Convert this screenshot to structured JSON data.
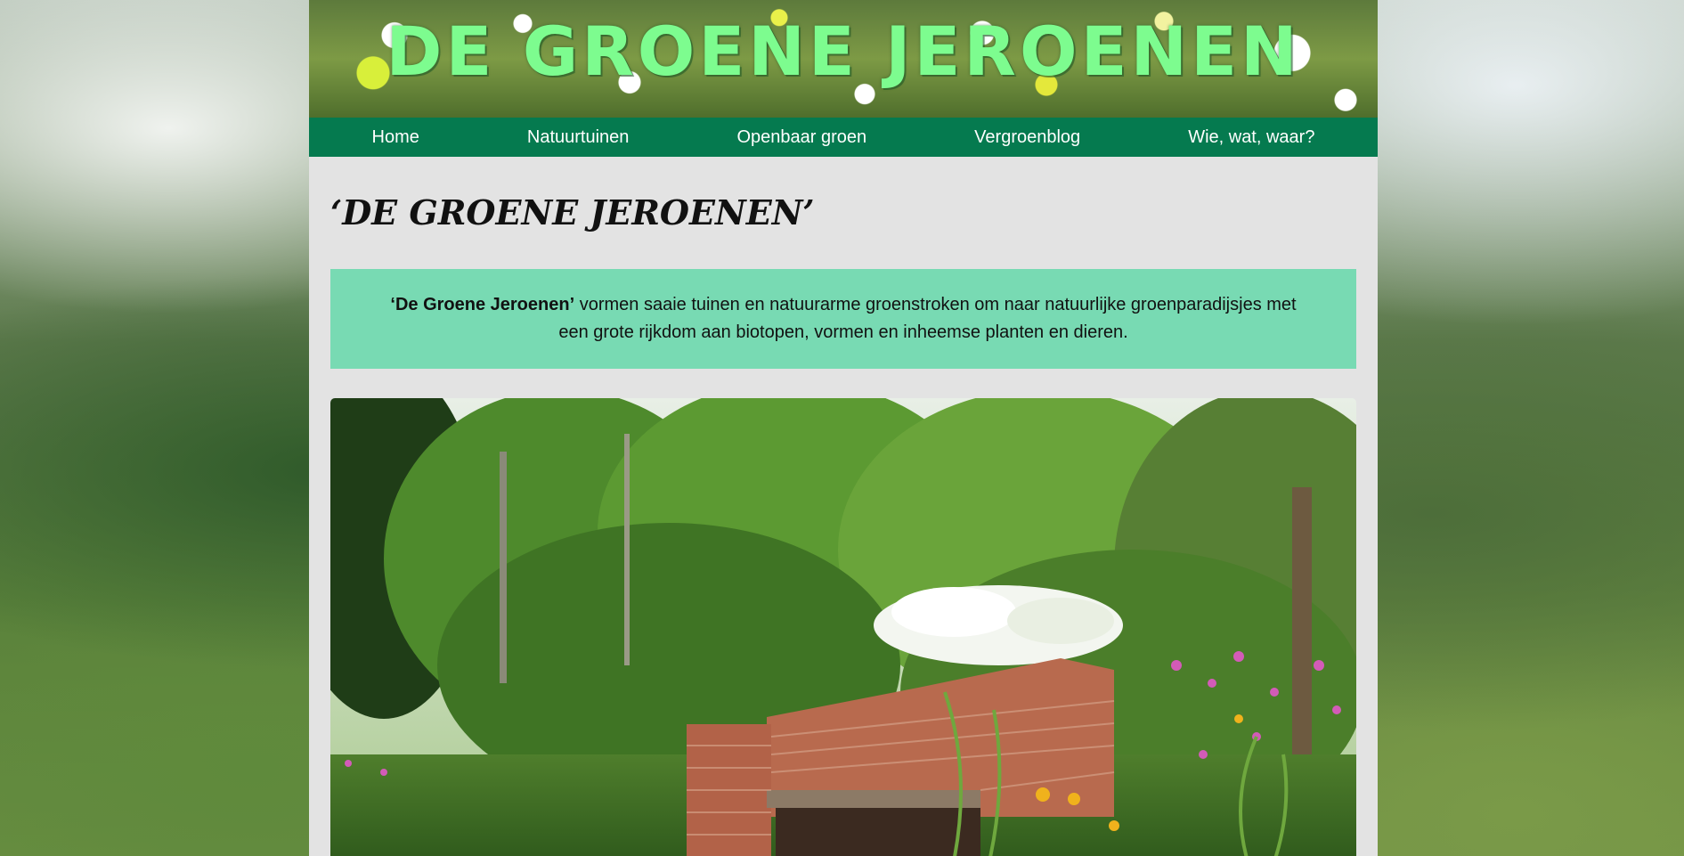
{
  "site": {
    "banner_title": "DE GROENE JEROENEN"
  },
  "nav": {
    "items": [
      {
        "label": "Home"
      },
      {
        "label": "Natuurtuinen"
      },
      {
        "label": "Openbaar groen"
      },
      {
        "label": "Vergroenblog"
      },
      {
        "label": "Wie, wat, waar?"
      }
    ]
  },
  "main": {
    "page_title": "‘DE GROENE JEROENEN’",
    "intro": {
      "bold": "‘De Groene Jeroenen’",
      "text": " vormen saaie tuinen en natuurarme groenstroken om naar natuurlijke groenparadijsjes met een grote rijkdom aan biotopen, vormen en inheemse planten en dieren."
    }
  },
  "colors": {
    "nav_background": "#057a4f",
    "intro_background": "#78dab3",
    "banner_title": "#7dfc8f",
    "content_background": "#e3e3e3"
  }
}
